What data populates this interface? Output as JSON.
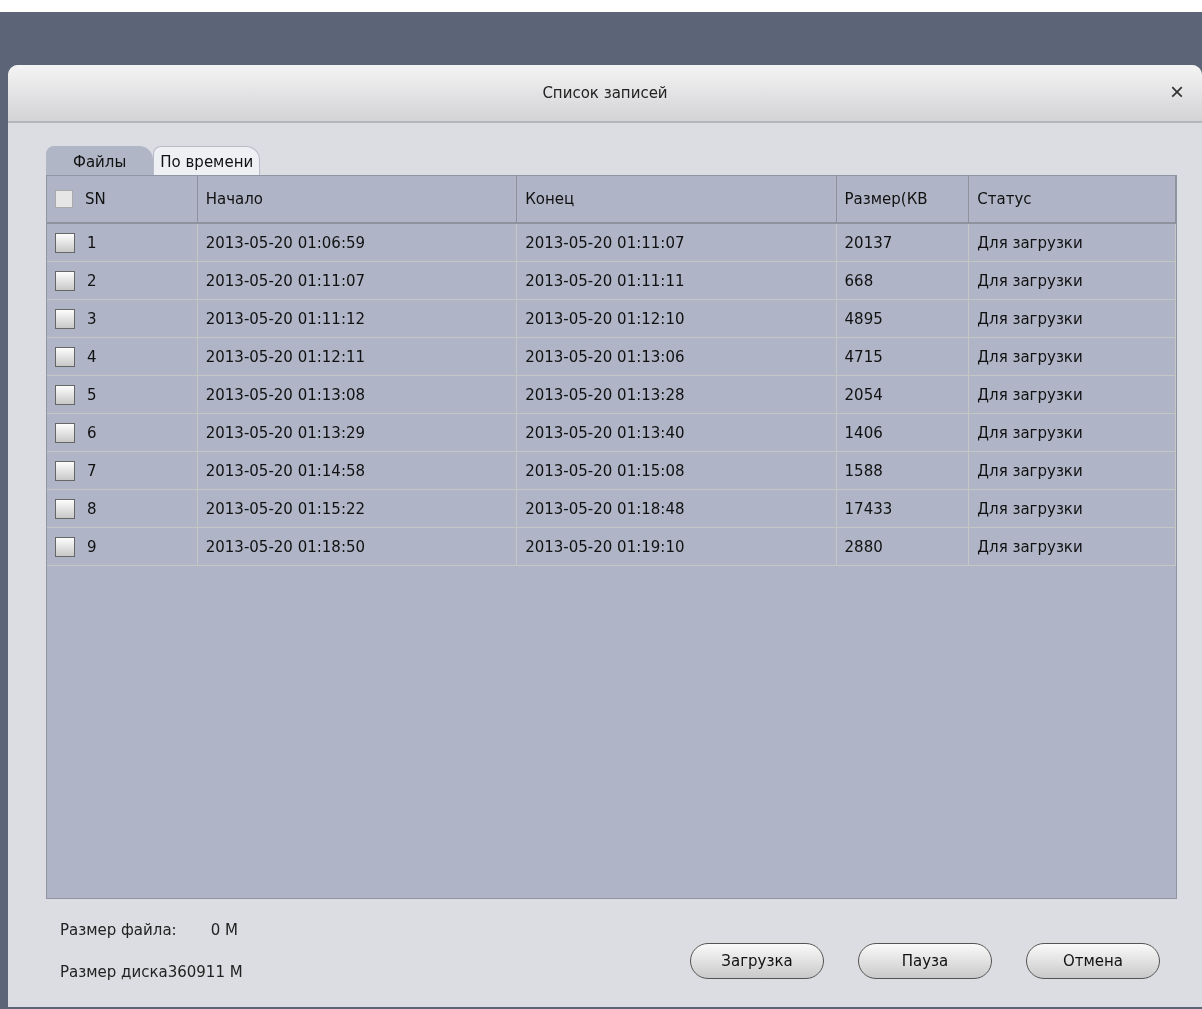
{
  "window": {
    "title": "Список записей",
    "close": "×"
  },
  "tabs": [
    {
      "label": "Файлы",
      "selected": true
    },
    {
      "label": "По времени",
      "selected": false
    }
  ],
  "table": {
    "select_all": {
      "checked": false
    },
    "columns": [
      "SN",
      "Начало",
      "Конец",
      "Размер(КВ",
      "Статус"
    ],
    "rows": [
      {
        "checked": false,
        "cells": [
          "1",
          "2013-05-20 01:06:59",
          "2013-05-20 01:11:07",
          "20137",
          "Для загрузки"
        ]
      },
      {
        "checked": false,
        "cells": [
          "2",
          "2013-05-20 01:11:07",
          "2013-05-20 01:11:11",
          "668",
          "Для загрузки"
        ]
      },
      {
        "checked": false,
        "cells": [
          "3",
          "2013-05-20 01:11:12",
          "2013-05-20 01:12:10",
          "4895",
          "Для загрузки"
        ]
      },
      {
        "checked": false,
        "cells": [
          "4",
          "2013-05-20 01:12:11",
          "2013-05-20 01:13:06",
          "4715",
          "Для загрузки"
        ]
      },
      {
        "checked": false,
        "cells": [
          "5",
          "2013-05-20 01:13:08",
          "2013-05-20 01:13:28",
          "2054",
          "Для загрузки"
        ]
      },
      {
        "checked": false,
        "cells": [
          "6",
          "2013-05-20 01:13:29",
          "2013-05-20 01:13:40",
          "1406",
          "Для загрузки"
        ]
      },
      {
        "checked": false,
        "cells": [
          "7",
          "2013-05-20 01:14:58",
          "2013-05-20 01:15:08",
          "1588",
          "Для загрузки"
        ]
      },
      {
        "checked": false,
        "cells": [
          "8",
          "2013-05-20 01:15:22",
          "2013-05-20 01:18:48",
          "17433",
          "Для загрузки"
        ]
      },
      {
        "checked": false,
        "cells": [
          "9",
          "2013-05-20 01:18:50",
          "2013-05-20 01:19:10",
          "2880",
          "Для загрузки"
        ]
      }
    ]
  },
  "footer": {
    "file_size_label": "Размер файла:",
    "file_size_value": "0 M",
    "disk_size": "Размер диска360911 M"
  },
  "buttons": [
    "Загрузка",
    "Пауза",
    "Отмена"
  ]
}
